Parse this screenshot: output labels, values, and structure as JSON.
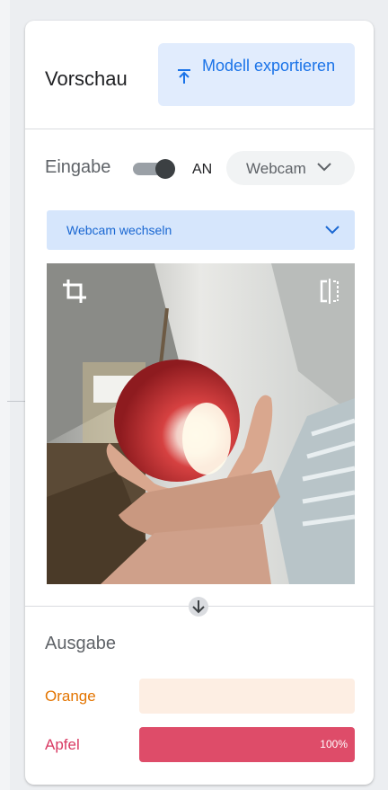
{
  "header": {
    "title": "Vorschau",
    "export_button": "Modell exportieren"
  },
  "input": {
    "label": "Eingabe",
    "toggle_state": "AN",
    "toggle_on": true,
    "source": "Webcam",
    "switch_dropdown": "Webcam wechseln"
  },
  "output": {
    "title": "Ausgabe",
    "classes": [
      {
        "label": "Orange",
        "percent": 0,
        "percent_label": "",
        "color": "#e37400",
        "track_color": "#fdeee3",
        "fill_color": "#f29a4a"
      },
      {
        "label": "Apfel",
        "percent": 100,
        "percent_label": "100%",
        "color": "#d93a63",
        "track_color": "#fbe3ea",
        "fill_color": "#de4c69"
      }
    ]
  },
  "icons": [
    "upload-icon",
    "chevron-down-icon",
    "crop-icon",
    "flip-icon",
    "arrow-down-icon"
  ]
}
